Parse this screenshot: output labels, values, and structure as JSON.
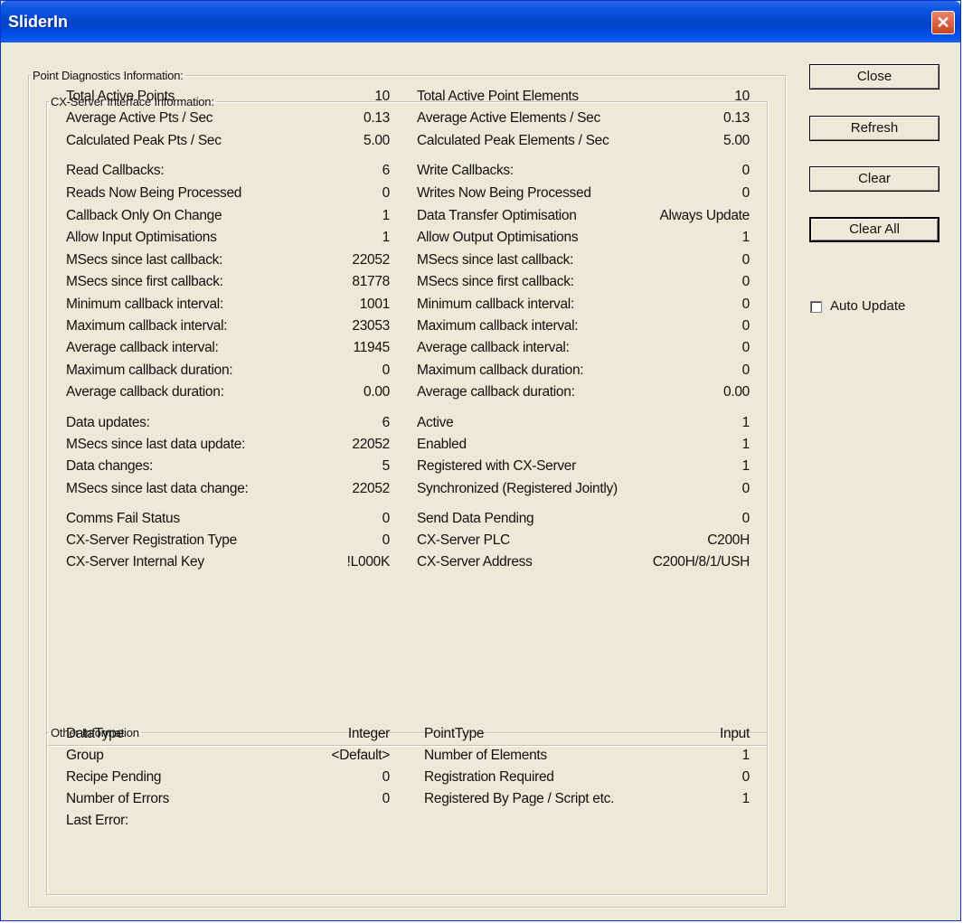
{
  "window": {
    "title": "SliderIn",
    "close_glyph": "✕"
  },
  "point_diagnostics_label": "Point Diagnostics Information:",
  "cx_server_label": "CX-Server Interface Information:",
  "other_label": "Other Information",
  "buttons": {
    "close": "Close",
    "refresh": "Refresh",
    "clear": "Clear",
    "clear_all": "Clear All"
  },
  "auto_update": {
    "label": "Auto Update",
    "checked": false
  },
  "cx_left": [
    {
      "label": "Total Active Points",
      "value": "10"
    },
    {
      "label": "Average Active Pts / Sec",
      "value": "0.13"
    },
    {
      "label": "Calculated Peak Pts / Sec",
      "value": "5.00"
    },
    {
      "label": "Read Callbacks:",
      "value": "6"
    },
    {
      "label": "Reads Now Being Processed",
      "value": "0"
    },
    {
      "label": "Callback Only On Change",
      "value": "1"
    },
    {
      "label": "Allow Input Optimisations",
      "value": "1"
    },
    {
      "label": "MSecs since last callback:",
      "value": "22052"
    },
    {
      "label": "MSecs since first callback:",
      "value": "81778"
    },
    {
      "label": "Minimum callback interval:",
      "value": "1001"
    },
    {
      "label": "Maximum callback interval:",
      "value": "23053"
    },
    {
      "label": "Average callback interval:",
      "value": "11945"
    },
    {
      "label": "Maximum callback duration:",
      "value": "0"
    },
    {
      "label": "Average callback duration:",
      "value": "0.00"
    },
    {
      "label": "Data updates:",
      "value": "6"
    },
    {
      "label": "MSecs since last data update:",
      "value": "22052"
    },
    {
      "label": "Data changes:",
      "value": "5"
    },
    {
      "label": "MSecs since last data change:",
      "value": "22052"
    },
    {
      "label": "Comms Fail Status",
      "value": "0"
    },
    {
      "label": "CX-Server Registration Type",
      "value": "0"
    },
    {
      "label": "CX-Server Internal Key",
      "value": "!L000K"
    }
  ],
  "cx_right": [
    {
      "label": "Total Active Point Elements",
      "value": "10"
    },
    {
      "label": "Average Active Elements / Sec",
      "value": "0.13"
    },
    {
      "label": "Calculated Peak Elements / Sec",
      "value": "5.00"
    },
    {
      "label": "Write Callbacks:",
      "value": "0"
    },
    {
      "label": "Writes Now Being Processed",
      "value": "0"
    },
    {
      "label": "Data Transfer Optimisation",
      "value": "Always Update"
    },
    {
      "label": "Allow Output Optimisations",
      "value": "1"
    },
    {
      "label": "MSecs since last callback:",
      "value": "0"
    },
    {
      "label": "MSecs since first callback:",
      "value": "0"
    },
    {
      "label": "Minimum callback interval:",
      "value": "0"
    },
    {
      "label": "Maximum callback interval:",
      "value": "0"
    },
    {
      "label": "Average callback interval:",
      "value": "0"
    },
    {
      "label": "Maximum callback duration:",
      "value": "0"
    },
    {
      "label": "Average callback duration:",
      "value": "0.00"
    },
    {
      "label": "Active",
      "value": "1"
    },
    {
      "label": "Enabled",
      "value": "1"
    },
    {
      "label": "Registered with CX-Server",
      "value": "1"
    },
    {
      "label": "Synchronized (Registered Jointly)",
      "value": "0"
    },
    {
      "label": "Send Data Pending",
      "value": "0"
    },
    {
      "label": "CX-Server PLC",
      "value": "C200H"
    },
    {
      "label": "CX-Server Address",
      "value": "C200H/8/1/USH"
    }
  ],
  "other_left": [
    {
      "label": "DataType",
      "value": "Integer"
    },
    {
      "label": "Group",
      "value": "<Default>"
    },
    {
      "label": "Recipe Pending",
      "value": "0"
    },
    {
      "label": "Number of Errors",
      "value": "0"
    },
    {
      "label": "Last Error:",
      "value": ""
    }
  ],
  "other_right": [
    {
      "label": "PointType",
      "value": "Input"
    },
    {
      "label": "Number of Elements",
      "value": "1"
    },
    {
      "label": "Registration Required",
      "value": "0"
    },
    {
      "label": "Registered By Page / Script etc.",
      "value": "1"
    }
  ]
}
